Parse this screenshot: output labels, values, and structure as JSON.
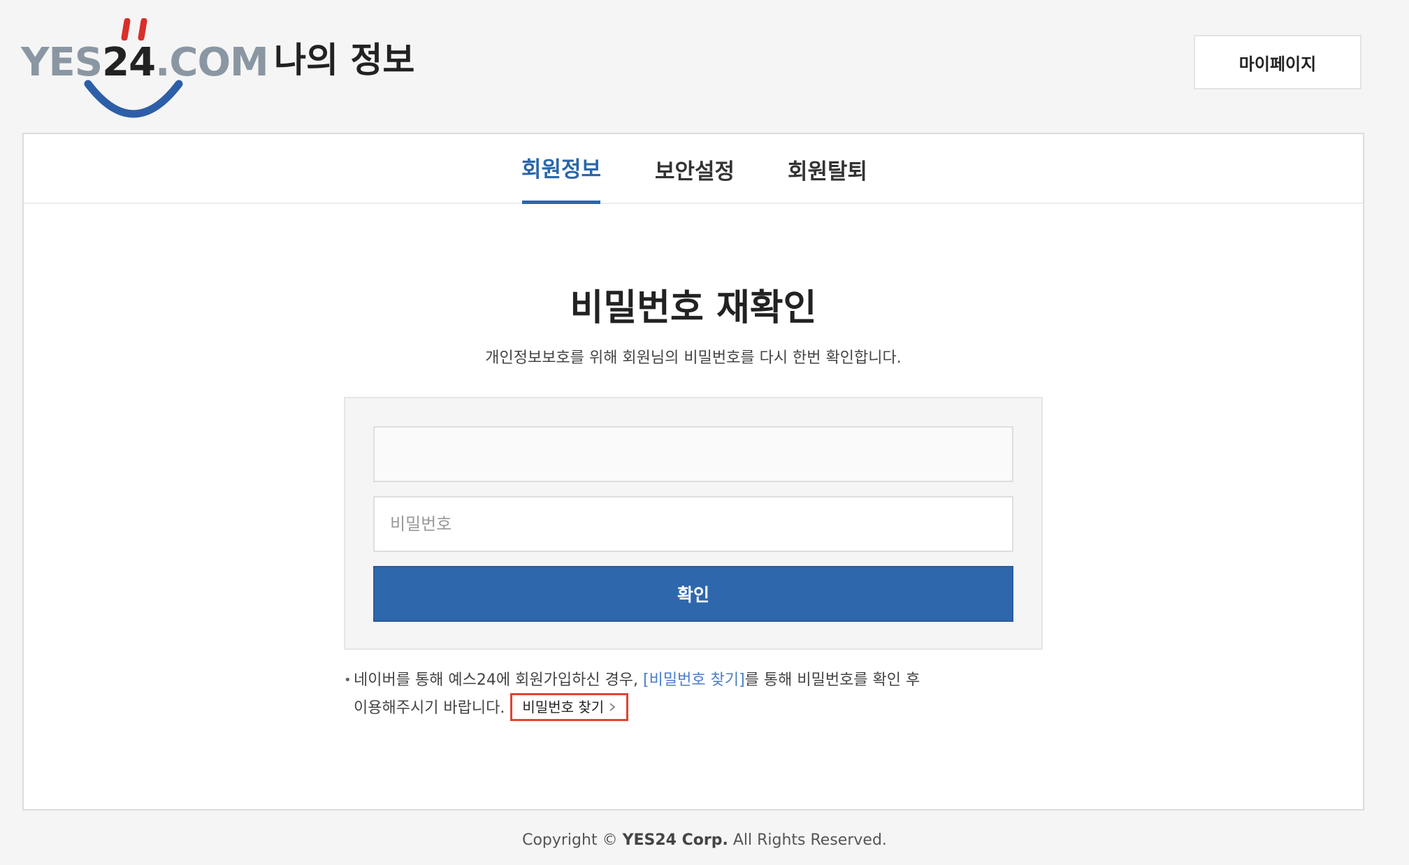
{
  "header": {
    "logo_text_prefix": "YES",
    "logo_text_num": "24",
    "logo_text_suffix": ".COM",
    "page_title": "나의 정보",
    "mypage_label": "마이페이지"
  },
  "tabs": [
    {
      "label": "회원정보",
      "active": true
    },
    {
      "label": "보안설정",
      "active": false
    },
    {
      "label": "회원탈퇴",
      "active": false
    }
  ],
  "reconfirm": {
    "title": "비밀번호 재확인",
    "description": "개인정보보호를 위해 회원님의 비밀번호를 다시 한번 확인합니다.",
    "id_value": "",
    "password_placeholder": "비밀번호",
    "submit_label": "확인"
  },
  "notice": {
    "bullet": "•",
    "line1_prefix": "네이버를 통해 예스24에 회원가입하신 경우, ",
    "line1_link": "[비밀번호 찾기]",
    "line1_suffix": "를 통해 비밀번호를 확인 후",
    "line2": "이용해주시기 바랍니다.",
    "find_pw_label": "비밀번호 찾기"
  },
  "footer": {
    "prefix": "Copyright © ",
    "company": "YES24 Corp.",
    "suffix": " All Rights Reserved."
  },
  "colors": {
    "accent": "#2c66ab",
    "button": "#2f67ad",
    "highlight_border": "#e04432",
    "logo_red": "#d9302c",
    "logo_blue": "#2d5ea8",
    "logo_gray": "#8a97a3"
  },
  "icons": {
    "logo_smile": "smile-icon",
    "chevron": "chevron-right-icon"
  }
}
